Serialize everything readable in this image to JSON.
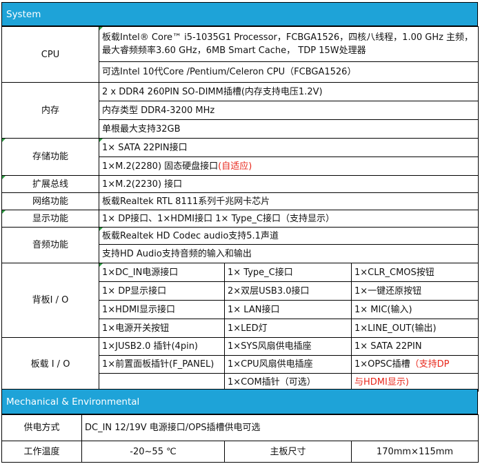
{
  "system_title": "System",
  "cpu": {
    "label": "CPU",
    "line1": "板载Intel® Core™ i5-1035G1 Processor，FCBGA1526，四核八线程，1.00 GHz 主频，最大睿频频率3.60 GHz，6MB Smart Cache， TDP 15W处理器",
    "line2": "可选Intel 10代Core /Pentium/Celeron CPU（FCBGA1526）"
  },
  "memory": {
    "label": "内存",
    "rows": [
      "2 x DDR4 260PIN SO-DIMM插槽(内存支持电压1.2V)",
      "内存类型 DDR4-3200 MHz",
      "单根最大支持32GB"
    ]
  },
  "storage": {
    "label": "存储功能",
    "row1": "1× SATA 22PIN接口",
    "row2_main": "1×M.2(2280) 固态硬盘接口",
    "row2_red": "(自适应)"
  },
  "expansion": {
    "label": "扩展总线",
    "value": "1×M.2(2230) 接口"
  },
  "network": {
    "label": "网络功能",
    "value": "板载Realtek  RTL 8111系列千兆网卡芯片"
  },
  "display": {
    "label": "显示功能",
    "value": "1× DP接口、1×HDMI接口 1× Type_C接口（支持显示）"
  },
  "audio": {
    "label": "音频功能",
    "rows": [
      "板载Realtek HD Codec audio支持5.1声道",
      "支持HD Audio支持音频的输入和输出"
    ]
  },
  "rear_io": {
    "label": "背板I / O",
    "rows": [
      [
        "1×DC_IN电源接口",
        "1× Type_C接口",
        "1×CLR_CMOS按钮"
      ],
      [
        "1× DP显示接口",
        "2×双层USB3.0接口",
        "1×一键还原按钮"
      ],
      [
        "1×HDMI显示接口",
        "1× LAN接口",
        "1× MIC(输入)"
      ],
      [
        "1×电源开关按钮",
        "1×LED灯",
        "1×LINE_OUT(输出)"
      ]
    ]
  },
  "onboard_io": {
    "label": "板载 I / O",
    "rows": [
      [
        "1×JUSB2.0 插针(4pin)",
        "1×SYS风扇供电插座",
        "1× SATA 22PIN"
      ],
      [
        "1×前置面板插针(F_PANEL)",
        "1×CPU风扇供电插座",
        "1×OPSC插槽"
      ],
      [
        "",
        "1×COM插针（可选）",
        ""
      ]
    ],
    "opsc_red_1": "（支持DP",
    "opsc_red_2": "与HDMI显示)"
  },
  "mech_title": "Mechanical & Environmental",
  "power": {
    "label": "供电方式",
    "value": "DC_IN 12/19V 电源接口/OPS插槽供电可选"
  },
  "env": {
    "temp_label": "工作温度",
    "temp_value": "-20~55 ℃",
    "size_label": "主板尺寸",
    "size_value": "170mm×115mm"
  }
}
